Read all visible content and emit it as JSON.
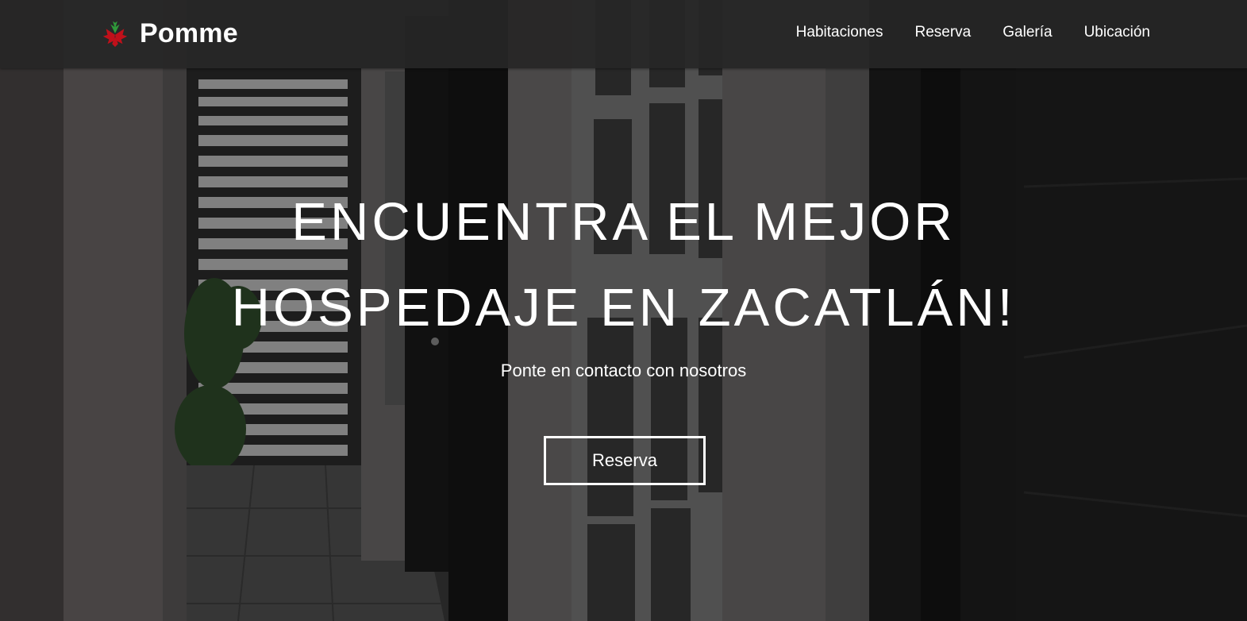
{
  "brand": {
    "name": "Pomme",
    "logo_icon": "ornament-logo-icon",
    "logo_colors": [
      "#c0101a",
      "#2f9a3a"
    ]
  },
  "nav": {
    "items": [
      {
        "label": "Habitaciones"
      },
      {
        "label": "Reserva"
      },
      {
        "label": "Galería"
      },
      {
        "label": "Ubicación"
      }
    ]
  },
  "hero": {
    "headline_line1": "ENCUENTRA EL MEJOR",
    "headline_line2": "HOSPEDAJE EN ZACATLÁN!",
    "subtitle": "Ponte en contacto con nosotros",
    "cta_label": "Reserva"
  },
  "colors": {
    "navbar_bg": "#262626",
    "text": "#ffffff"
  }
}
